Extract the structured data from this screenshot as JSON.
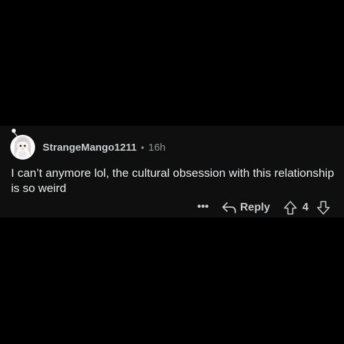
{
  "comment": {
    "username": "StrangeMango1211",
    "separator": "•",
    "time_ago": "16h",
    "body": "I can’t anymore lol, the cultural obsession with this relationship is so weird",
    "avatar_icon": "snoo-avatar-icon"
  },
  "actions": {
    "more_label": "•••",
    "reply_label": "Reply",
    "vote_count": "4"
  },
  "colors": {
    "background": "#000000",
    "card": "#0f0f0f",
    "text": "#e8eaeb",
    "muted": "#8e9294"
  }
}
